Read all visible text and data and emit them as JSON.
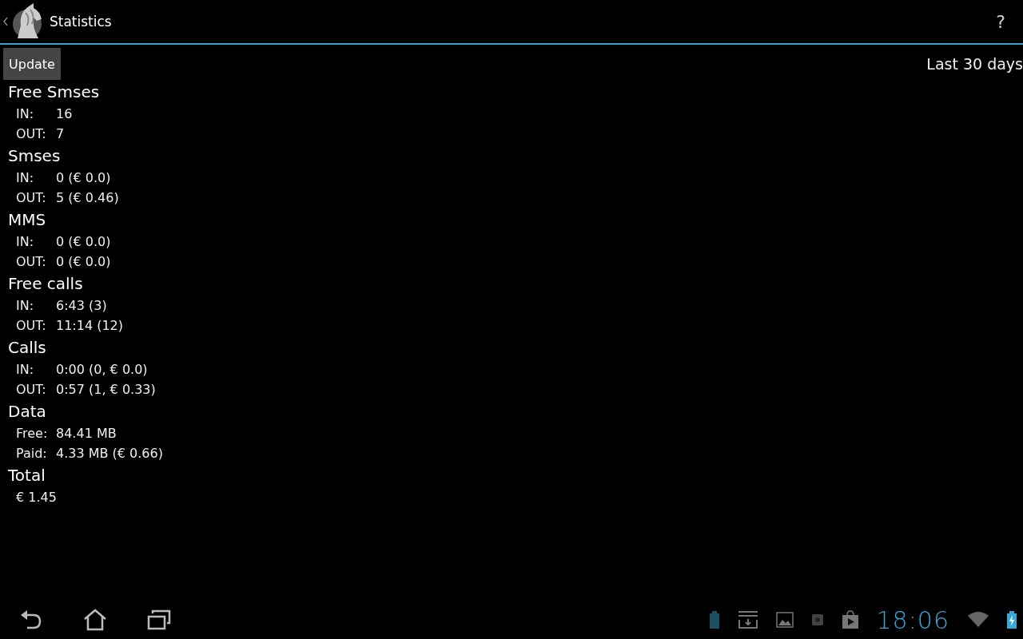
{
  "action_bar": {
    "title": "Statistics",
    "help": "?"
  },
  "update_button": "Update",
  "period": "Last 30 days",
  "sections": [
    {
      "title": "Free Smses",
      "rows": [
        {
          "label": "IN:",
          "value": "16"
        },
        {
          "label": "OUT:",
          "value": "7"
        }
      ]
    },
    {
      "title": "Smses",
      "rows": [
        {
          "label": "IN:",
          "value": "0 (€ 0.0)"
        },
        {
          "label": "OUT:",
          "value": "5 (€ 0.46)"
        }
      ]
    },
    {
      "title": "MMS",
      "rows": [
        {
          "label": "IN:",
          "value": "0 (€ 0.0)"
        },
        {
          "label": "OUT:",
          "value": "0 (€ 0.0)"
        }
      ]
    },
    {
      "title": "Free calls",
      "rows": [
        {
          "label": "IN:",
          "value": "6:43 (3)"
        },
        {
          "label": "OUT:",
          "value": "11:14 (12)"
        }
      ]
    },
    {
      "title": "Calls",
      "rows": [
        {
          "label": "IN:",
          "value": "0:00 (0, € 0.0)"
        },
        {
          "label": "OUT:",
          "value": "0:57 (1, € 0.33)"
        }
      ]
    },
    {
      "title": "Data",
      "rows": [
        {
          "label": "Free:",
          "value": "84.41 MB"
        },
        {
          "label": "Paid:",
          "value": "4.33 MB (€ 0.66)"
        }
      ]
    },
    {
      "title": "Total",
      "rows": [
        {
          "value": "€ 1.45"
        }
      ]
    }
  ],
  "status_bar": {
    "time": "18:06"
  }
}
